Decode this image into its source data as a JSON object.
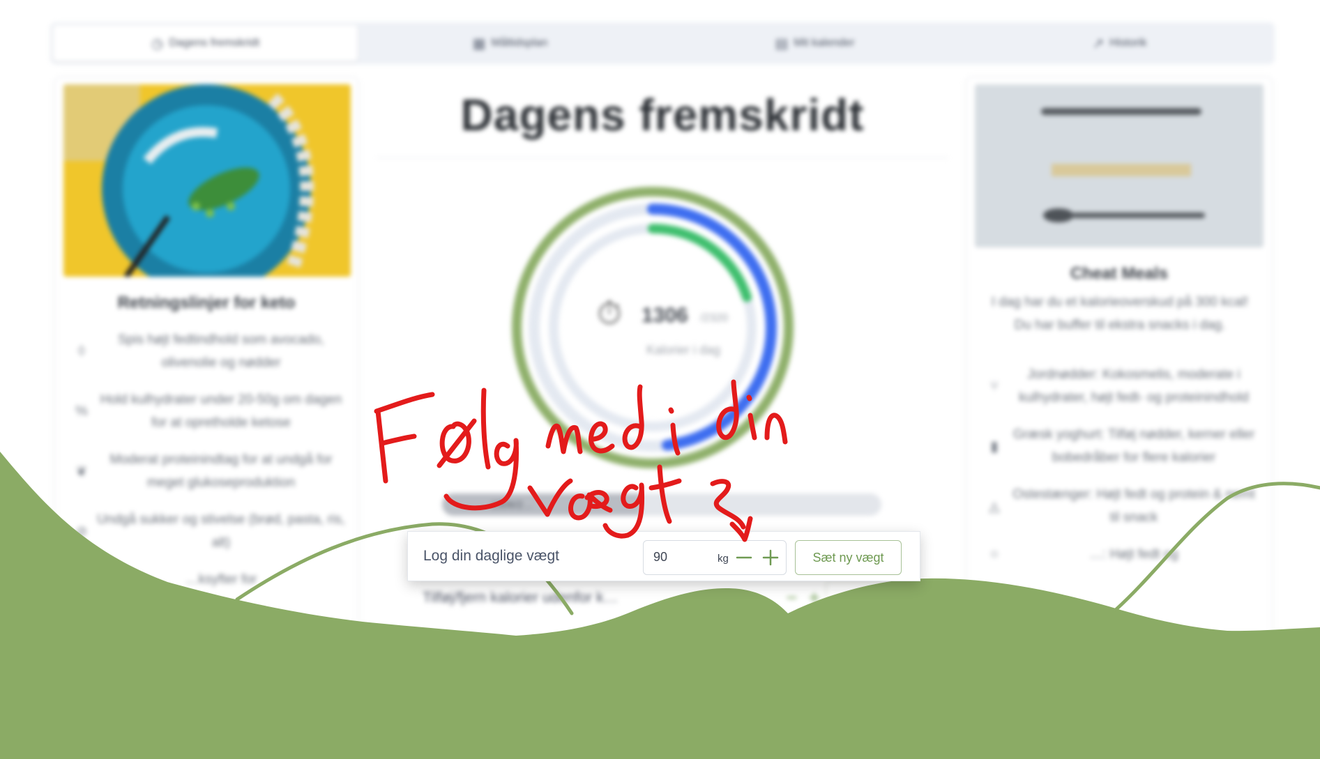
{
  "tabs": [
    {
      "label": "Dagens fremskridt",
      "icon": "clock-icon",
      "active": true
    },
    {
      "label": "Måltidsplan",
      "icon": "calendar-icon",
      "active": false
    },
    {
      "label": "Mit kalender",
      "icon": "calendar-days-icon",
      "active": false
    },
    {
      "label": "Historik",
      "icon": "trend-icon",
      "active": false
    }
  ],
  "left_card": {
    "title": "Retningslinjer for keto",
    "items": [
      {
        "icon": "drop-icon",
        "text": "Spis højt fedtindhold som avocado, olivenolie og nødder"
      },
      {
        "icon": "percent-icon",
        "text": "Hold kulhydrater under 20-50g om dagen for at opretholde ketose"
      },
      {
        "icon": "leaf-icon",
        "text": "Moderat proteinindtag for at undgå for meget glukoseproduktion"
      },
      {
        "icon": "ban-icon",
        "text": "Undgå sukker og stivelse (brød, pasta, ris, alt)"
      },
      {
        "icon": "plus-icon",
        "text": "…ksyfter for"
      }
    ]
  },
  "center": {
    "title": "Dagens fremskridt",
    "ring": {
      "value": "1306",
      "goal": "/2320",
      "label": "Kalorier i dag",
      "outer_fraction": 0.48,
      "inner_fraction": 0.2
    },
    "progress": {
      "label": "1306/2…",
      "fraction": 0.45
    },
    "calorie_row": {
      "label": "Tilføj/fjern kalorier udenfor k…"
    }
  },
  "right_card": {
    "title": "Cheat Meals",
    "intro": "I dag har du et kalorieoverskud på 300 kcal! Du har buffer til ekstra snacks i dag.",
    "items": [
      {
        "icon": "fork-icon",
        "text": "Jordnødder: Kokosmelis, moderate i kulhydrater, højt fedt- og proteinindhold"
      },
      {
        "icon": "cup-icon",
        "text": "Græsk yoghurt: Tilføj nødder, kerner eller bobedråber for flere kalorier"
      },
      {
        "icon": "cheese-icon",
        "text": "Ostestænger: Højt fedt og protein & nemt til snack"
      },
      {
        "icon": "egg-icon",
        "text": "…: Højt fedt og"
      }
    ]
  },
  "weight_card": {
    "label": "Log din daglige vægt",
    "value": "90",
    "unit": "kg",
    "button_label": "Sæt ny vægt"
  },
  "annotation": {
    "line1": "Følg med i din",
    "line2": "vægt"
  },
  "colors": {
    "wave_green": "#8bab65",
    "ring_outer": "#8fb06b",
    "ring_blue": "#3e6ef0",
    "ring_green": "#3fbf6e",
    "annotation_red": "#e31b1b",
    "button_green": "#6f9a52"
  }
}
